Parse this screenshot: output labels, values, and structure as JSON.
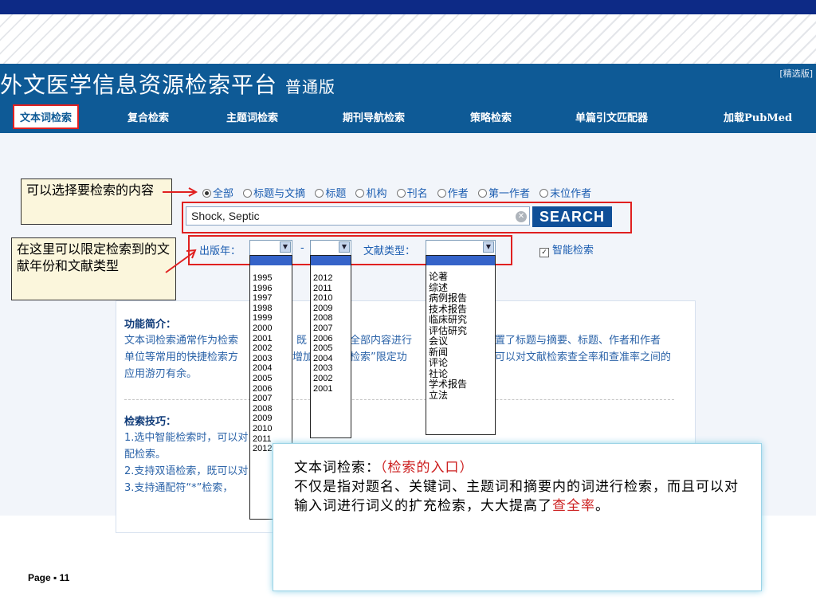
{
  "header": {
    "title": "外文医学信息资源检索平台",
    "edition": "普通版",
    "selected_link": "[精选版]"
  },
  "nav": {
    "tabs": [
      {
        "label": "文本词检索",
        "active": true
      },
      {
        "label": "复合检索"
      },
      {
        "label": "主题词检索"
      },
      {
        "label": "期刊导航检索"
      },
      {
        "label": "策略检索"
      },
      {
        "label": "单篇引文匹配器"
      },
      {
        "label": "加载PubMed"
      }
    ]
  },
  "annotations": {
    "scope": "可以选择要检索的内容",
    "filters": "在这里可以限定检索到的文献年份和文献类型"
  },
  "search": {
    "scopes": [
      {
        "label": "全部",
        "selected": true
      },
      {
        "label": "标题与文摘"
      },
      {
        "label": "标题"
      },
      {
        "label": "机构"
      },
      {
        "label": "刊名"
      },
      {
        "label": "作者"
      },
      {
        "label": "第一作者"
      },
      {
        "label": "末位作者"
      }
    ],
    "query": "Shock, Septic",
    "button": "SEARCH"
  },
  "filters": {
    "year_label": "出版年：",
    "dash": "-",
    "type_label": "文献类型：",
    "smart_search": "智能检索",
    "smart_checked": true,
    "year_from_options": [
      "1995",
      "1996",
      "1997",
      "1998",
      "1999",
      "2000",
      "2001",
      "2002",
      "2003",
      "2004",
      "2005",
      "2006",
      "2007",
      "2008",
      "2009",
      "2010",
      "2011",
      "2012"
    ],
    "year_to_options": [
      "2012",
      "2011",
      "2010",
      "2009",
      "2008",
      "2007",
      "2006",
      "2005",
      "2004",
      "2003",
      "2002",
      "2001"
    ],
    "doc_type_options": [
      "论著",
      "综述",
      "病例报告",
      "技术报告",
      "临床研究",
      "评估研究",
      "会议",
      "新闻",
      "评论",
      "社论",
      "学术报告",
      "立法"
    ]
  },
  "intro": {
    "title": "功能简介：",
    "lines": [
      "文本词检索通常作为检索",
      "单位等常用的快捷检索方",
      "应用游刃有余。"
    ],
    "right_lines": [
      "置了标题与摘要、标题、作者和作者",
      "可以对文献检索查全率和查准率之间的"
    ],
    "mid_fragments": [
      "既",
      "增加",
      "对全部内容进行",
      "能检索”限定功"
    ],
    "tips_title": "检索技巧：",
    "tips": [
      "1.选中智能检索时，可以对",
      "配检索。",
      "2.支持双语检索，既可以对",
      "3.支持通配符“*”检索，"
    ]
  },
  "callout": {
    "head": "文本词检索：",
    "head_red": "（检索的入口）",
    "body": "不仅是指对题名、关键词、主题词和摘要内的词进行检索，而且可以对输入词进行词义的扩充检索，大大提高了",
    "red_tail": "查全率",
    "end": "。"
  },
  "footer": {
    "page": "Page ▪ 11"
  },
  "colors": {
    "nav_blue": "#0e5a96",
    "top_band": "#0d2a86",
    "highlight_red": "#e02020"
  }
}
